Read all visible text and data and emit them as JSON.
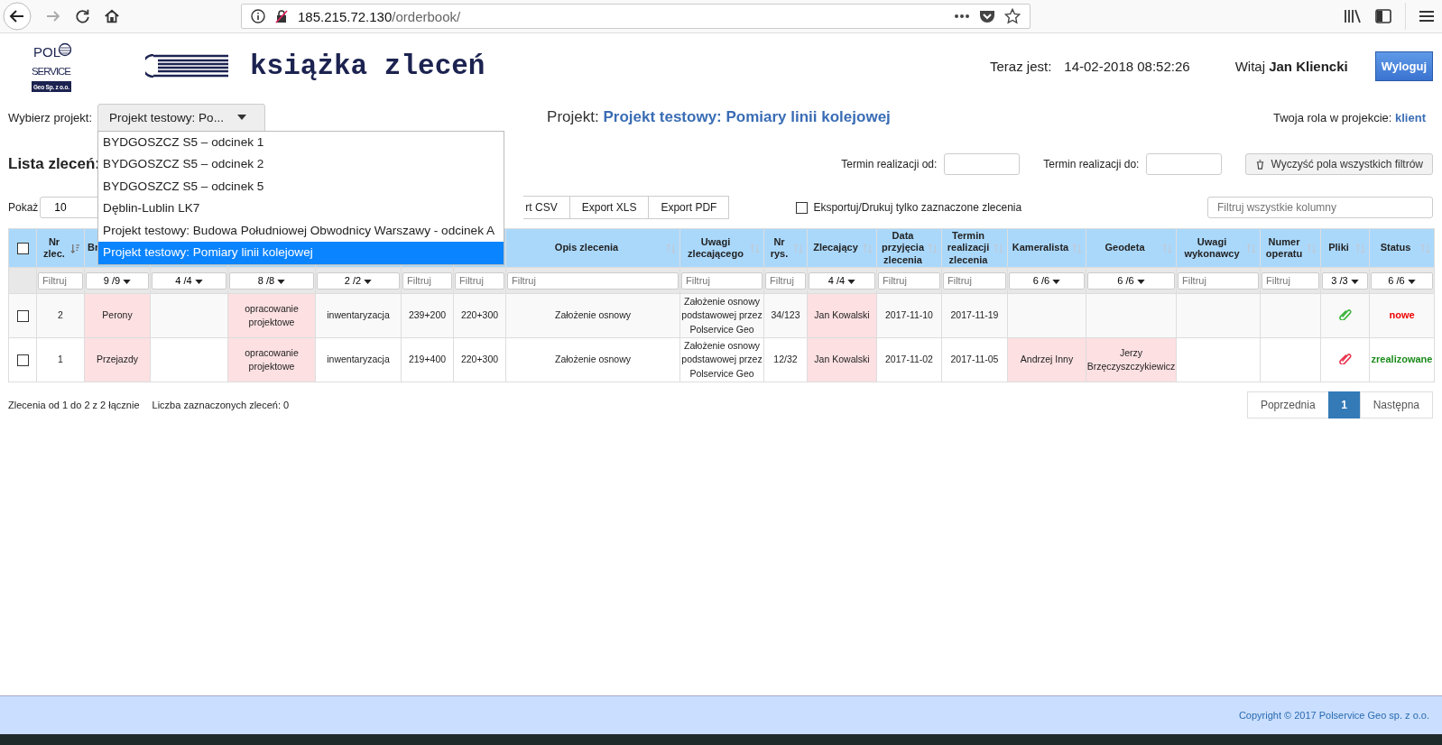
{
  "browser": {
    "url_host": "185.215.72.130",
    "url_path": "/orderbook/"
  },
  "logo": {
    "lines": [
      "POL",
      "SERVICE",
      "Geo Sp. z o.o."
    ]
  },
  "app_title": "książka zleceń",
  "clock": {
    "label": "Teraz jest:",
    "value": "14-02-2018 08:52:26"
  },
  "user": {
    "greeting": "Witaj",
    "name": "Jan Kliencki"
  },
  "logout_button": "Wyloguj",
  "project_select": {
    "label": "Wybierz projekt:",
    "value": "Projekt testowy: Po...",
    "expanded": true,
    "options": [
      {
        "label": "BYDGOSZCZ S5 – odcinek 1",
        "selected": false
      },
      {
        "label": "BYDGOSZCZ S5 – odcinek 2",
        "selected": false
      },
      {
        "label": "BYDGOSZCZ S5 – odcinek 5",
        "selected": false
      },
      {
        "label": "Dęblin-Lublin LK7",
        "selected": false
      },
      {
        "label": "Projekt testowy: Budowa Południowej Obwodnicy Warszawy - odcinek A",
        "selected": false
      },
      {
        "label": "Projekt testowy: Pomiary linii kolejowej",
        "selected": true
      }
    ]
  },
  "project": {
    "label": "Projekt:",
    "name": "Projekt testowy: Pomiary linii kolejowej"
  },
  "role": {
    "label": "Twoja rola w projekcie:",
    "value": "klient"
  },
  "list_title": "Lista zleceń:",
  "date_filters": [
    {
      "label": "Termin realizacji od:"
    },
    {
      "label": "Termin realizacji do:"
    }
  ],
  "clear_filters_button": "Wyczyść pola wszystkich filtrów",
  "page_length": {
    "label": "Pokaż",
    "value": "10"
  },
  "export_buttons": [
    "rt CSV",
    "Export XLS",
    "Export PDF"
  ],
  "export_selected_only": {
    "label": "Eksportuj/Drukuj tylko zaznaczone zlecenia",
    "checked": false
  },
  "global_filter": {
    "placeholder": "Filtruj wszystkie kolumny"
  },
  "table": {
    "select_all_checked": false,
    "columns": [
      {
        "label": "Nr zlec.",
        "sorted": true,
        "filter": {
          "kind": "text",
          "placeholder": "Filtruj"
        }
      },
      {
        "label": "Br",
        "filter": {
          "kind": "select",
          "value": "9 /9"
        }
      },
      {
        "filter": {
          "kind": "select",
          "value": "4 /4"
        }
      },
      {
        "filter": {
          "kind": "select",
          "value": "8 /8"
        }
      },
      {
        "filter": {
          "kind": "select",
          "value": "2 /2"
        }
      },
      {
        "filter": {
          "kind": "text",
          "placeholder": "Filtruj"
        }
      },
      {
        "filter": {
          "kind": "text",
          "placeholder": "Filtruj"
        }
      },
      {
        "label": "Opis zlecenia",
        "sorted": false,
        "filter": {
          "kind": "text",
          "placeholder": "Filtruj"
        }
      },
      {
        "label": "Uwagi zlecającego",
        "sorted": false,
        "filter": {
          "kind": "text",
          "placeholder": "Filtruj"
        }
      },
      {
        "label": "Nr rys.",
        "sorted": false,
        "filter": {
          "kind": "text",
          "placeholder": "Filtruj"
        }
      },
      {
        "label": "Zlecający",
        "sorted": false,
        "filter": {
          "kind": "select",
          "value": "4 /4"
        }
      },
      {
        "label": "Data przyjęcia zlecenia",
        "sorted": false,
        "filter": {
          "kind": "text",
          "placeholder": "Filtruj"
        }
      },
      {
        "label": "Termin realizacji zlecenia",
        "sorted": false,
        "filter": {
          "kind": "text",
          "placeholder": "Filtruj"
        }
      },
      {
        "label": "Kameralista",
        "sorted": false,
        "filter": {
          "kind": "select",
          "value": "6 /6"
        }
      },
      {
        "label": "Geodeta",
        "sorted": false,
        "filter": {
          "kind": "select",
          "value": "6 /6"
        }
      },
      {
        "label": "Uwagi wykonawcy",
        "sorted": false,
        "filter": {
          "kind": "text",
          "placeholder": "Filtruj"
        }
      },
      {
        "label": "Numer operatu",
        "sorted": false,
        "filter": {
          "kind": "text",
          "placeholder": "Filtruj"
        }
      },
      {
        "label": "Pliki",
        "sorted": false,
        "filter": {
          "kind": "select",
          "value": "3 /3"
        }
      },
      {
        "label": "Status",
        "sorted": false,
        "filter": {
          "kind": "select",
          "value": "6 /6"
        }
      }
    ],
    "rows": [
      {
        "checked": false,
        "cells": [
          {
            "kind": "text",
            "text": "2",
            "highlight": false
          },
          {
            "kind": "text",
            "text": "Perony",
            "highlight": true
          },
          {
            "kind": "text",
            "highlight": false
          },
          {
            "kind": "text",
            "text": "opracowanie projektowe",
            "highlight": true
          },
          {
            "kind": "text",
            "text": "inwentaryzacja",
            "highlight": false
          },
          {
            "kind": "text",
            "text": "239+200",
            "highlight": false
          },
          {
            "kind": "text",
            "text": "220+300",
            "highlight": false
          },
          {
            "kind": "text",
            "text": "Założenie osnowy",
            "highlight": false
          },
          {
            "kind": "text",
            "text": "Założenie osnowy podstawowej przez Polservice Geo",
            "highlight": false
          },
          {
            "kind": "text",
            "text": "34/123",
            "highlight": false
          },
          {
            "kind": "text",
            "text": "Jan Kowalski",
            "highlight": true
          },
          {
            "kind": "text",
            "text": "2017-11-10",
            "highlight": false
          },
          {
            "kind": "text",
            "text": "2017-11-19",
            "highlight": false
          },
          {
            "kind": "text",
            "highlight": false
          },
          {
            "kind": "text",
            "highlight": false
          },
          {
            "kind": "text",
            "highlight": false
          },
          {
            "kind": "text",
            "highlight": false
          },
          {
            "kind": "file",
            "color": "#3cb43c",
            "highlight": false
          },
          {
            "kind": "status",
            "text": "nowe",
            "color": "#ee0000",
            "highlight": false
          }
        ]
      },
      {
        "checked": false,
        "cells": [
          {
            "kind": "text",
            "text": "1",
            "highlight": false
          },
          {
            "kind": "text",
            "text": "Przejazdy",
            "highlight": true
          },
          {
            "kind": "text",
            "highlight": false
          },
          {
            "kind": "text",
            "text": "opracowanie projektowe",
            "highlight": true
          },
          {
            "kind": "text",
            "text": "inwentaryzacja",
            "highlight": false
          },
          {
            "kind": "text",
            "text": "219+400",
            "highlight": false
          },
          {
            "kind": "text",
            "text": "220+300",
            "highlight": false
          },
          {
            "kind": "text",
            "text": "Założenie osnowy",
            "highlight": false
          },
          {
            "kind": "text",
            "text": "Założenie osnowy podstawowej przez Polservice Geo",
            "highlight": false
          },
          {
            "kind": "text",
            "text": "12/32",
            "highlight": false
          },
          {
            "kind": "text",
            "text": "Jan Kowalski",
            "highlight": true
          },
          {
            "kind": "text",
            "text": "2017-11-02",
            "highlight": false
          },
          {
            "kind": "text",
            "text": "2017-11-05",
            "highlight": false
          },
          {
            "kind": "text",
            "text": "Andrzej Inny",
            "highlight": true
          },
          {
            "kind": "text",
            "text": "Jerzy Brzęczyszczykiewicz",
            "highlight": true
          },
          {
            "kind": "text",
            "highlight": false
          },
          {
            "kind": "text",
            "highlight": false
          },
          {
            "kind": "file",
            "color": "#e8344e",
            "highlight": false
          },
          {
            "kind": "status",
            "text": "zrealizowane",
            "color": "#1a8a1a",
            "highlight": false
          }
        ]
      }
    ]
  },
  "table_info": [
    "Zlecenia od 1 do 2 z 2 łącznie",
    "Liczba zaznaczonych zleceń: 0"
  ],
  "pagination": [
    {
      "label": "Poprzednia",
      "kind": "nav",
      "selected": false
    },
    {
      "label": "1",
      "kind": "page",
      "selected": true
    },
    {
      "label": "Następna",
      "kind": "nav",
      "selected": false
    }
  ],
  "footer": "Copyright © 2017 Polservice Geo sp. z o.o."
}
